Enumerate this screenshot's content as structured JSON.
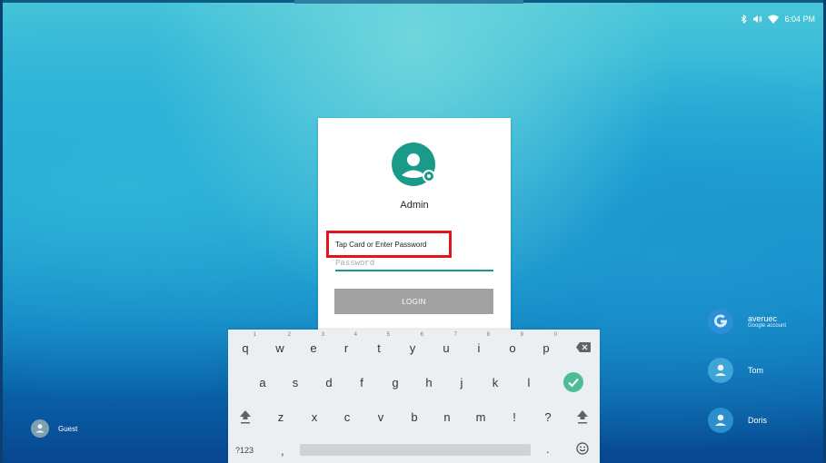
{
  "status": {
    "time": "6:04 PM"
  },
  "login": {
    "username": "Admin",
    "prompt": "Tap Card or Enter Password",
    "password_placeholder": "Password",
    "login_label": "LOGIN"
  },
  "keyboard": {
    "row1": [
      {
        "k": "q",
        "h": "1"
      },
      {
        "k": "w",
        "h": "2"
      },
      {
        "k": "e",
        "h": "3"
      },
      {
        "k": "r",
        "h": "4"
      },
      {
        "k": "t",
        "h": "5"
      },
      {
        "k": "y",
        "h": "6"
      },
      {
        "k": "u",
        "h": "7"
      },
      {
        "k": "i",
        "h": "8"
      },
      {
        "k": "o",
        "h": "9"
      },
      {
        "k": "p",
        "h": "0"
      }
    ],
    "row2": [
      "a",
      "s",
      "d",
      "f",
      "g",
      "h",
      "j",
      "k",
      "l"
    ],
    "row3": [
      "z",
      "x",
      "c",
      "v",
      "b",
      "n",
      "m",
      "!",
      "?"
    ],
    "key_123": "?123",
    "comma": ",",
    "period": "."
  },
  "accounts": [
    {
      "name": "averuec",
      "sub": "Google account"
    },
    {
      "name": "Tom"
    },
    {
      "name": "Doris"
    }
  ],
  "guest": {
    "name": "Guest"
  },
  "colors": {
    "accent": "#1a9a89",
    "highlight": "#e2141c",
    "button": "#a2a2a2"
  }
}
